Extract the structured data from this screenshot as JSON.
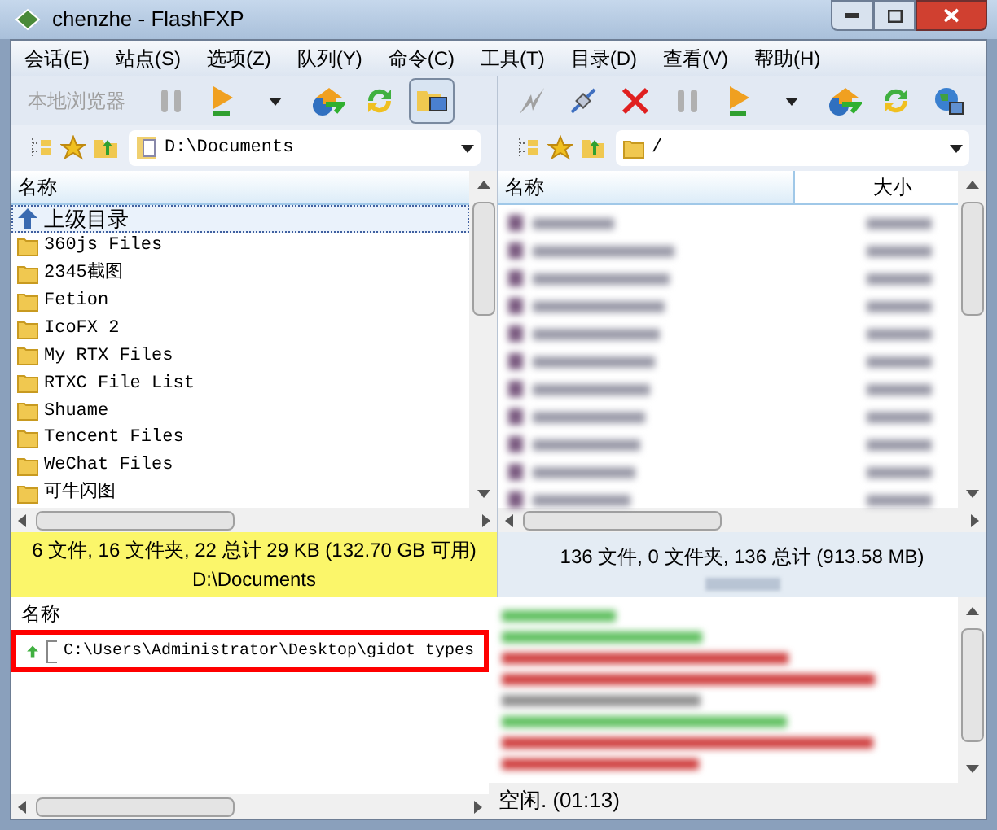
{
  "window": {
    "title": "chenzhe - FlashFXP"
  },
  "menu": [
    "会话(E)",
    "站点(S)",
    "选项(Z)",
    "队列(Y)",
    "命令(C)",
    "工具(T)",
    "目录(D)",
    "查看(V)",
    "帮助(H)"
  ],
  "left": {
    "toolbar_label": "本地浏览器",
    "address": "D:\\Documents",
    "column": "名称",
    "rows": [
      {
        "kind": "parent",
        "name": "上级目录",
        "selected": true
      },
      {
        "kind": "folder",
        "name": "360js Files",
        "selected": false
      },
      {
        "kind": "folder",
        "name": "2345截图",
        "selected": false
      },
      {
        "kind": "folder",
        "name": "Fetion",
        "selected": false
      },
      {
        "kind": "folder",
        "name": "IcoFX 2",
        "selected": false
      },
      {
        "kind": "folder",
        "name": "My RTX Files",
        "selected": false
      },
      {
        "kind": "folder",
        "name": "RTXC File List",
        "selected": false
      },
      {
        "kind": "folder",
        "name": "Shuame",
        "selected": false
      },
      {
        "kind": "folder",
        "name": "Tencent Files",
        "selected": false
      },
      {
        "kind": "folder",
        "name": "WeChat Files",
        "selected": false
      },
      {
        "kind": "folder",
        "name": "可牛闪图",
        "selected": false
      }
    ],
    "status": [
      "6 文件, 16 文件夹, 22 总计 29 KB (132.70 GB 可用)",
      "D:\\Documents"
    ]
  },
  "right": {
    "address": "/",
    "columns": [
      "名称",
      "大小"
    ],
    "status": "136 文件, 0 文件夹, 136 总计 (913.58 MB)"
  },
  "queue": {
    "column": "名称",
    "items": [
      {
        "kind": "upload",
        "path": "C:\\Users\\Administrator\\Desktop\\gidot types",
        "highlighted": true
      }
    ]
  },
  "status_bar": "空闲. (01:13)"
}
